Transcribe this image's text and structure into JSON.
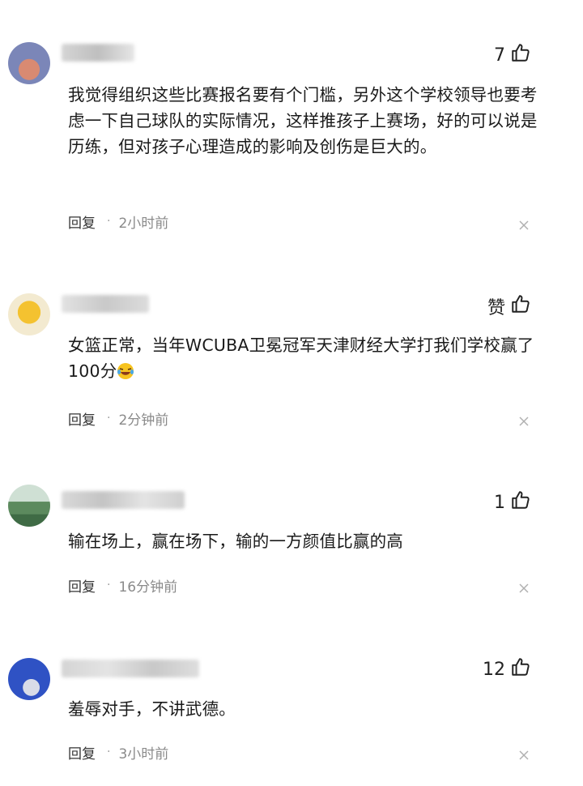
{
  "comments": [
    {
      "likes": "7",
      "text": "我觉得组织这些比赛报名要有个门槛，另外这个学校领导也要考虑一下自己球队的实际情况，这样推孩子上赛场，好的可以说是历练，但对孩子心理造成的影响及创伤是巨大的。",
      "reply": "回复",
      "time": "2小时前"
    },
    {
      "likes": "赞",
      "text": "女篮正常，当年WCUBA卫冕冠军天津财经大学打我们学校赢了100分",
      "reply": "回复",
      "time": "2分钟前"
    },
    {
      "likes": "1",
      "text": "输在场上，赢在场下，输的一方颜值比赢的高",
      "reply": "回复",
      "time": "16分钟前"
    },
    {
      "likes": "12",
      "text": "羞辱对手，不讲武德。",
      "reply": "回复",
      "time": "3小时前"
    }
  ],
  "icons": {
    "like": "thumbs-up-icon",
    "close": "close-icon",
    "emoji": "laughing-crying-emoji"
  }
}
